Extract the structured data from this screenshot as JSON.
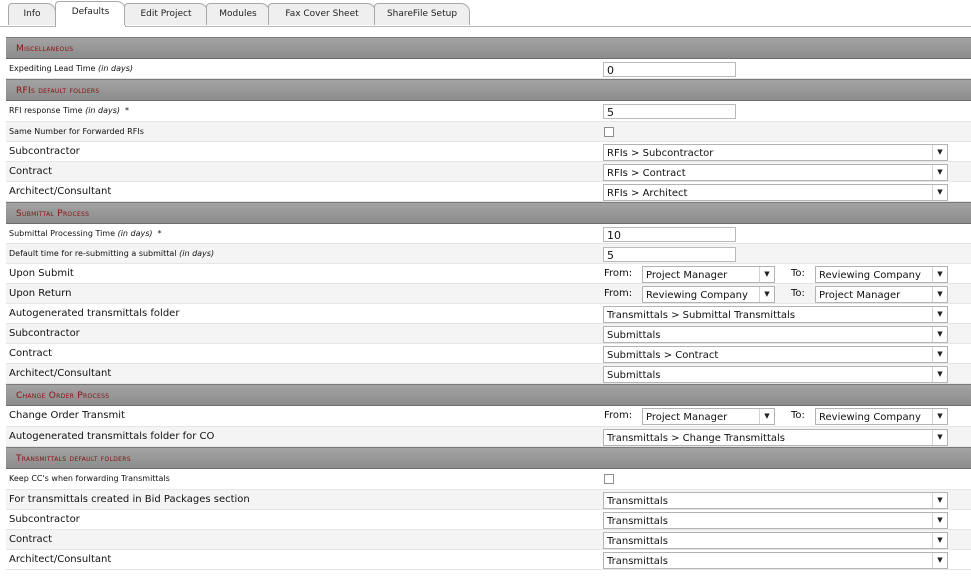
{
  "tabs": [
    {
      "label": "Info"
    },
    {
      "label": "Defaults"
    },
    {
      "label": "Edit Project"
    },
    {
      "label": "Modules"
    },
    {
      "label": "Fax Cover Sheet"
    },
    {
      "label": "ShareFile Setup"
    }
  ],
  "active_tab": "Defaults",
  "sections": {
    "misc": {
      "title": "Miscellaneous",
      "expediting_label": "Expediting Lead Time",
      "expediting_unit": "(in days)",
      "expediting_value": "0"
    },
    "rfis": {
      "title": "RFIs default folders",
      "response_label": "RFI response Time",
      "response_unit": "(in days)",
      "response_required": "*",
      "response_value": "5",
      "same_number_label": "Same Number for Forwarded RFIs",
      "same_number_checked": false,
      "subcontractor_label": "Subcontractor",
      "subcontractor_value": "RFIs > Subcontractor",
      "contract_label": "Contract",
      "contract_value": "RFIs > Contract",
      "architect_label": "Architect/Consultant",
      "architect_value": "RFIs > Architect"
    },
    "submittal": {
      "title": "Submittal Process",
      "processing_label": "Submittal Processing Time",
      "processing_unit": "(in days)",
      "processing_required": "*",
      "processing_value": "10",
      "resubmit_label": "Default time for re-submitting a submittal",
      "resubmit_unit": "(in days)",
      "resubmit_value": "5",
      "upon_submit_label": "Upon Submit",
      "upon_submit_from": "Project Manager",
      "upon_submit_to": "Reviewing Company",
      "upon_return_label": "Upon Return",
      "upon_return_from": "Reviewing Company",
      "upon_return_to": "Project Manager",
      "from_label": "From:",
      "to_label": "To:",
      "auto_folder_label": "Autogenerated transmittals folder",
      "auto_folder_value": "Transmittals > Submittal Transmittals",
      "subcontractor_label": "Subcontractor",
      "subcontractor_value": "Submittals",
      "contract_label": "Contract",
      "contract_value": "Submittals > Contract",
      "architect_label": "Architect/Consultant",
      "architect_value": "Submittals"
    },
    "change_order": {
      "title": "Change Order Process",
      "transmit_label": "Change Order Transmit",
      "transmit_from": "Project Manager",
      "transmit_to": "Reviewing Company",
      "from_label": "From:",
      "to_label": "To:",
      "auto_folder_label": "Autogenerated transmittals folder for CO",
      "auto_folder_value": "Transmittals > Change Transmittals"
    },
    "transmittals": {
      "title": "Transmittals default folders",
      "keep_cc_label": "Keep CC's when forwarding Transmittals",
      "keep_cc_checked": false,
      "bid_label": "For transmittals created in Bid Packages section",
      "bid_value": "Transmittals",
      "subcontractor_label": "Subcontractor",
      "subcontractor_value": "Transmittals",
      "contract_label": "Contract",
      "contract_value": "Transmittals",
      "architect_label": "Architect/Consultant",
      "architect_value": "Transmittals"
    }
  },
  "icons": {
    "dropdown": "chevron-down-icon"
  },
  "colors": {
    "section_title": "#8a0f0f",
    "section_bg": "#999999"
  }
}
